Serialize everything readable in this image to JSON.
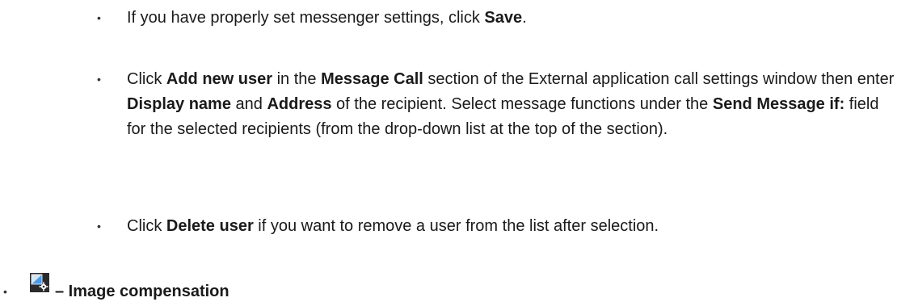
{
  "items": [
    {
      "bullet": "•",
      "parts": [
        {
          "text": "If you have properly set messenger settings, click ",
          "bold": false
        },
        {
          "text": "Save",
          "bold": true
        },
        {
          "text": ".",
          "bold": false
        }
      ]
    },
    {
      "bullet": "•",
      "parts": [
        {
          "text": "Click ",
          "bold": false
        },
        {
          "text": "Add new user",
          "bold": true
        },
        {
          "text": " in the ",
          "bold": false
        },
        {
          "text": "Message Call",
          "bold": true
        },
        {
          "text": " section of the External application call settings window then enter ",
          "bold": false
        },
        {
          "text": "Display name",
          "bold": true
        },
        {
          "text": " and ",
          "bold": false
        },
        {
          "text": "Address",
          "bold": true
        },
        {
          "text": " of the recipient. Select message functions under the ",
          "bold": false
        },
        {
          "text": "Send Message if:",
          "bold": true
        },
        {
          "text": " field for the selected recipients (from the drop-down list at the top of the section).",
          "bold": false
        }
      ]
    },
    {
      "bullet": "•",
      "parts": [
        {
          "text": "Click ",
          "bold": false
        },
        {
          "text": "Delete user",
          "bold": true
        },
        {
          "text": " if you want to remove a user from the list after selection.",
          "bold": false
        }
      ]
    }
  ],
  "section": {
    "bullet": "•",
    "icon": "image-compensation-icon",
    "title": "– Image compensation",
    "icon_colors": {
      "dark": "#2b2b2b",
      "blue": "#4a9be8",
      "light": "#cfe6fb"
    }
  }
}
